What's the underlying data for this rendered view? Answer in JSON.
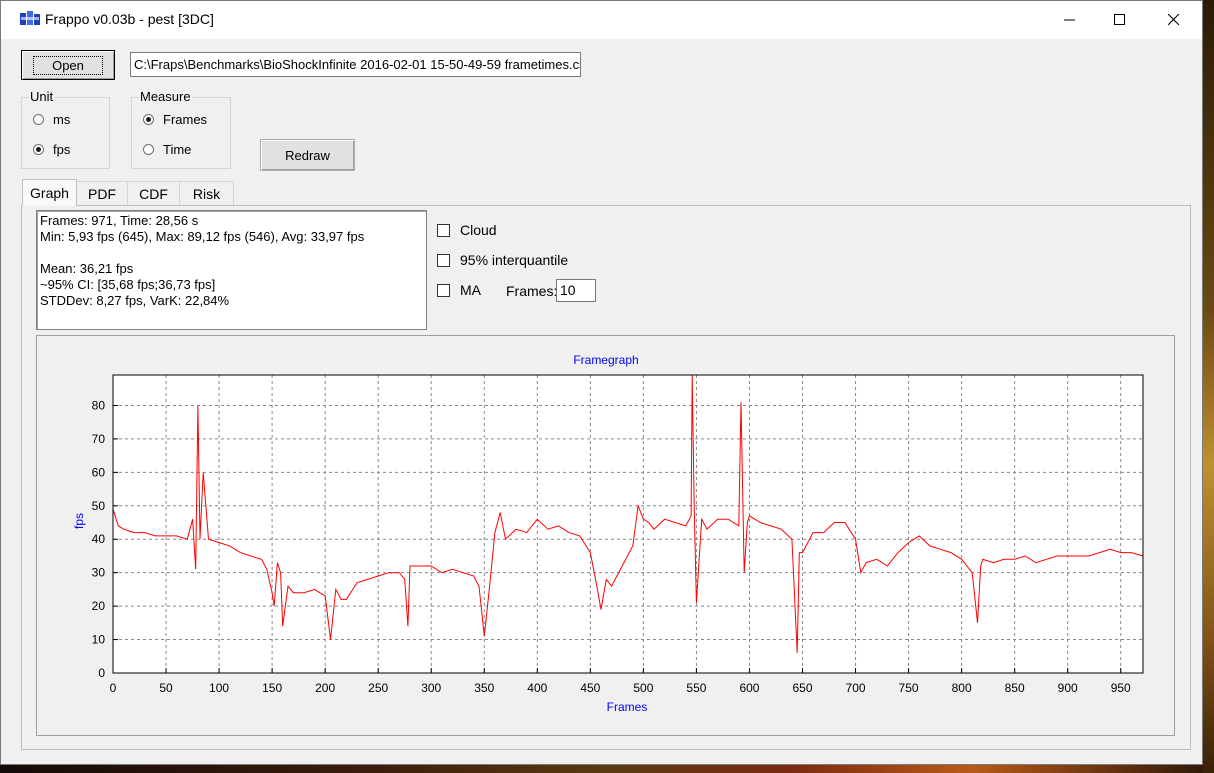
{
  "window": {
    "title": "Frappo v0.03b - pest [3DC]",
    "minimize_glyph": "—",
    "maximize_glyph": "☐",
    "close_glyph": "✕"
  },
  "toolbar": {
    "open_label": "Open",
    "file_path": "C:\\Fraps\\Benchmarks\\BioShockInfinite 2016-02-01 15-50-49-59 frametimes.csv",
    "redraw_label": "Redraw"
  },
  "unit_group": {
    "title": "Unit",
    "options": [
      {
        "label": "ms",
        "selected": false
      },
      {
        "label": "fps",
        "selected": true
      }
    ]
  },
  "measure_group": {
    "title": "Measure",
    "options": [
      {
        "label": "Frames",
        "selected": true
      },
      {
        "label": "Time",
        "selected": false
      }
    ]
  },
  "tabs": [
    {
      "label": "Graph",
      "active": true
    },
    {
      "label": "PDF",
      "active": false
    },
    {
      "label": "CDF",
      "active": false
    },
    {
      "label": "Risk",
      "active": false
    }
  ],
  "stats": {
    "line1": "Frames: 971, Time: 28,56 s",
    "line2": "Min: 5,93 fps (645), Max: 89,12 fps (546), Avg: 33,97 fps",
    "line3": "",
    "line4": "Mean: 36,21 fps",
    "line5": "~95% CI: [35,68 fps;36,73 fps]",
    "line6": "STDDev: 8,27 fps, VarK: 22,84%"
  },
  "options": {
    "cloud_label": "Cloud",
    "cloud_checked": false,
    "interquantile_label": "95% interquantile",
    "interquantile_checked": false,
    "ma_label": "MA",
    "ma_checked": false,
    "frames_label": "Frames:",
    "frames_value": "10"
  },
  "chart_data": {
    "type": "line",
    "title": "Framegraph",
    "xlabel": "Frames",
    "ylabel": "fps",
    "xlim": [
      0,
      971
    ],
    "ylim": [
      0,
      89.12
    ],
    "x_ticks": [
      0,
      50,
      100,
      150,
      200,
      250,
      300,
      350,
      400,
      450,
      500,
      550,
      600,
      650,
      700,
      750,
      800,
      850,
      900,
      950
    ],
    "y_ticks": [
      0,
      10,
      20,
      30,
      40,
      50,
      60,
      70,
      80
    ],
    "grid": true,
    "line_color": "#ff0000",
    "label_color": "#0000ff",
    "series": [
      {
        "x": [
          0,
          5,
          10,
          20,
          30,
          40,
          50,
          60,
          70,
          75,
          78,
          80,
          82,
          85,
          90,
          100,
          110,
          115,
          120,
          130,
          140,
          145,
          150,
          152,
          155,
          158,
          160,
          165,
          170,
          180,
          190,
          200,
          205,
          210,
          215,
          220,
          230,
          240,
          250,
          260,
          270,
          275,
          278,
          280,
          290,
          300,
          310,
          320,
          330,
          340,
          345,
          350,
          355,
          360,
          365,
          370,
          380,
          390,
          400,
          410,
          420,
          430,
          440,
          450,
          455,
          460,
          465,
          470,
          480,
          490,
          495,
          500,
          505,
          510,
          520,
          530,
          540,
          545,
          546,
          548,
          550,
          555,
          560,
          570,
          580,
          590,
          592,
          595,
          598,
          600,
          610,
          620,
          630,
          640,
          645,
          647,
          650,
          660,
          670,
          680,
          690,
          700,
          705,
          710,
          720,
          730,
          740,
          750,
          760,
          770,
          780,
          790,
          800,
          810,
          815,
          818,
          820,
          830,
          840,
          850,
          860,
          870,
          880,
          890,
          900,
          910,
          920,
          930,
          940,
          950,
          960,
          971
        ],
        "y": [
          49,
          44,
          43,
          42,
          42,
          41,
          41,
          41,
          40,
          46,
          31,
          80,
          40,
          60,
          40,
          39,
          38,
          37,
          36,
          35,
          34,
          31,
          24,
          20,
          33,
          30,
          14,
          26,
          24,
          24,
          25,
          23,
          10,
          25,
          22,
          22,
          27,
          28,
          29,
          30,
          30,
          28,
          14,
          32,
          32,
          32,
          30,
          31,
          30,
          29,
          26,
          11,
          26,
          42,
          48,
          40,
          43,
          42,
          46,
          43,
          44,
          42,
          41,
          36,
          28,
          19,
          28,
          26,
          32,
          38,
          50,
          46,
          45,
          43,
          46,
          45,
          44,
          47,
          89,
          48,
          21,
          46,
          43,
          46,
          46,
          44,
          81,
          30,
          45,
          47,
          45,
          44,
          43,
          40,
          6,
          36,
          36,
          42,
          42,
          45,
          45,
          40,
          30,
          33,
          34,
          32,
          36,
          39,
          41,
          38,
          37,
          36,
          34,
          30,
          15,
          32,
          34,
          33,
          34,
          34,
          35,
          33,
          34,
          35,
          35,
          35,
          35,
          36,
          37,
          36,
          36,
          35
        ]
      }
    ]
  }
}
